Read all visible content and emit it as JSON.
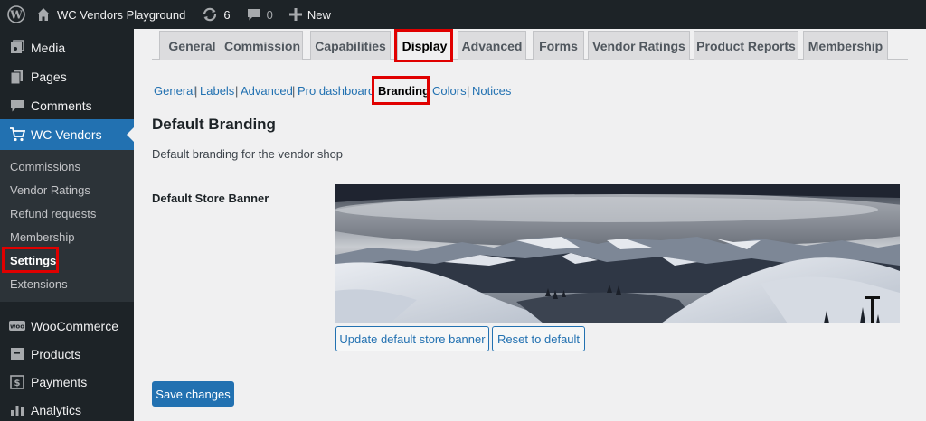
{
  "adminbar": {
    "site_name": "WC Vendors Playground",
    "updates_count": "6",
    "comments_count": "0",
    "new_label": "New"
  },
  "sidebar": {
    "items": [
      {
        "label": "Media",
        "icon": "media-icon"
      },
      {
        "label": "Pages",
        "icon": "pages-icon"
      },
      {
        "label": "Comments",
        "icon": "comments-icon"
      },
      {
        "label": "WC Vendors",
        "icon": "cart-icon"
      },
      {
        "label": "WooCommerce",
        "icon": "woo-icon"
      },
      {
        "label": "Products",
        "icon": "products-icon"
      },
      {
        "label": "Payments",
        "icon": "payments-icon"
      },
      {
        "label": "Analytics",
        "icon": "analytics-icon"
      }
    ],
    "submenu": [
      "Commissions",
      "Vendor Ratings",
      "Refund requests",
      "Membership",
      "Settings",
      "Extensions"
    ]
  },
  "tabs": [
    "General",
    "Commission",
    "Capabilities",
    "Display",
    "Advanced",
    "Forms",
    "Vendor Ratings",
    "Product Reports",
    "Membership"
  ],
  "subtabs": [
    "General",
    "Labels",
    "Advanced",
    "Pro dashboard",
    "Branding",
    "Colors",
    "Notices"
  ],
  "section": {
    "title": "Default Branding",
    "description": "Default branding for the vendor shop",
    "field_label": "Default Store Banner"
  },
  "buttons": {
    "update_banner": "Update default store banner",
    "reset": "Reset to default",
    "save": "Save changes"
  },
  "colors": {
    "accent": "#2271b1",
    "highlight": "#e00000",
    "sidebar_bg": "#1d2327"
  }
}
